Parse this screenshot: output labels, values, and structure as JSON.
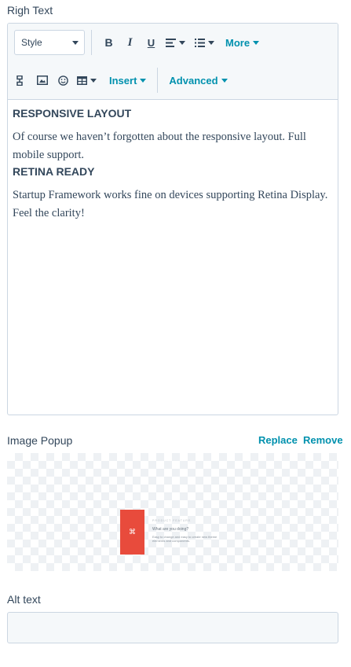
{
  "righ_text": {
    "label": "Righ Text",
    "toolbar": {
      "style_select": "Style",
      "more_label": "More",
      "insert_label": "Insert",
      "advanced_label": "Advanced",
      "icons": [
        "bold-icon",
        "italic-icon",
        "underline-icon",
        "align-icon",
        "list-icon",
        "source-code-icon",
        "image-icon",
        "emoji-icon",
        "table-icon"
      ]
    },
    "content": {
      "heading1": "RESPONSIVE LAYOUT",
      "para1": "Of course we haven’t forgotten about the responsive layout. Full mobile support.",
      "heading2": "RETINA READY",
      "para2": "Startup Framework works fine on devices supporting Retina Display. Feel the clarity!"
    }
  },
  "image_popup": {
    "label": "Image Popup",
    "replace_label": "Replace",
    "remove_label": "Remove",
    "thumbnail": {
      "line1": "PRODUCT FEATURE",
      "line2": "What are you doing?",
      "line3": "Easy to change and easy to create new theme elements and components."
    }
  },
  "alt_text": {
    "label": "Alt text",
    "value": "",
    "placeholder": ""
  },
  "colors": {
    "accent": "#0091ae",
    "text": "#33475b",
    "border": "#cbd6e2",
    "toolbar_bg": "#f5f8fa",
    "thumb_red": "#e84b3c"
  }
}
